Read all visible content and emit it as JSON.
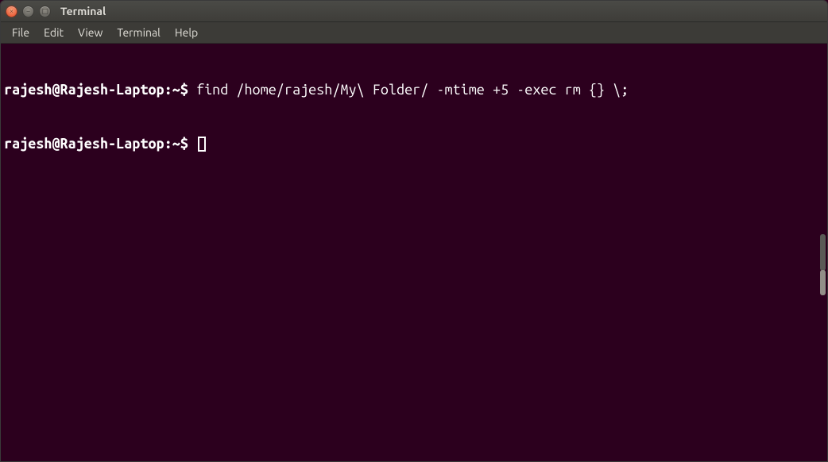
{
  "window": {
    "title": "Terminal"
  },
  "menubar": {
    "items": [
      "File",
      "Edit",
      "View",
      "Terminal",
      "Help"
    ]
  },
  "terminal": {
    "lines": [
      {
        "userhost": "rajesh@Rajesh-Laptop",
        "sep": ":",
        "path": "~",
        "dollar": "$",
        "command": "find /home/rajesh/My\\ Folder/ -mtime +5 -exec rm {} \\;"
      },
      {
        "userhost": "rajesh@Rajesh-Laptop",
        "sep": ":",
        "path": "~",
        "dollar": "$",
        "command": ""
      }
    ]
  }
}
